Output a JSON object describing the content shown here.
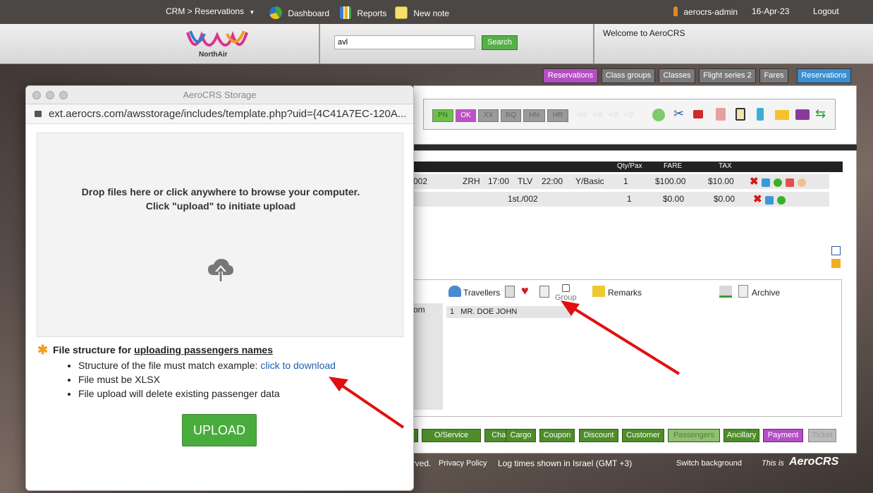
{
  "topbar": {
    "crm_menu": "CRM > Reservations",
    "dashboard": "Dashboard",
    "reports": "Reports",
    "new_note": "New note",
    "user": "aerocrs-admin",
    "date": "16-Apr-23",
    "logout": "Logout"
  },
  "header": {
    "logo_text": "NorthAir",
    "search_value": "avl",
    "search_button": "Search",
    "welcome": "Welcome to AeroCRS"
  },
  "nav_tabs": [
    "Reservations",
    "Class groups",
    "Classes",
    "Flight series 2",
    "Fares",
    "Reservations"
  ],
  "status_buttons": [
    "PN",
    "OK",
    "XX",
    "RQ",
    "HN",
    "HR"
  ],
  "table": {
    "headers": [
      "Qty/Pax",
      "FARE",
      "TAX"
    ],
    "rows": [
      {
        "col1": "002",
        "from": "ZRH",
        "dep": "17:00",
        "to": "TLV",
        "arr": "22:00",
        "cls": "Y/Basic",
        "qty": "1",
        "fare": "$100.00",
        "tax": "$10.00"
      },
      {
        "col1": "1st./002",
        "qty": "1",
        "fare": "$0.00",
        "tax": "$0.00"
      }
    ]
  },
  "passengers": {
    "travellers": "Travellers",
    "group": "Group",
    "remarks": "Remarks",
    "archive": "Archive",
    "partial_left": "om",
    "passenger_line": "1   MR. DOE JOHN"
  },
  "bottom_buttons": [
    "O/Service",
    "Charter",
    "Cargo",
    "Coupon",
    "Discount",
    "Customer",
    "Passengers",
    "Ancillary",
    "Payment",
    "Ticket"
  ],
  "footer": {
    "rights": "erved.",
    "privacy": "Privacy Policy",
    "log_times": "Log times shown in Israel (GMT +3)",
    "switch_bg": "Switch background",
    "this_is": "This is",
    "brand": "AeroCRS"
  },
  "modal": {
    "title": "AeroCRS Storage",
    "url": "ext.aerocrs.com/awsstorage/includes/template.php?uid={4C41A7EC-120A...",
    "drop_line1": "Drop files here or click anywhere to browse your computer.",
    "drop_line2": "Click \"upload\" to initiate upload",
    "info_title_prefix": "File structure for ",
    "info_title_link": "uploading passengers names",
    "bullet1_prefix": "Structure of the file must match example: ",
    "bullet1_link": "click to download",
    "bullet2": "File must be XLSX",
    "bullet3": "File upload will delete existing passenger data",
    "upload_button": "UPLOAD"
  },
  "colors": {
    "accent_green": "#4aab3d",
    "tab_purple": "#b44ec4",
    "tab_gray": "#7a7a7a",
    "tab_blue": "#3a8fd0",
    "arrow_red": "#e01010"
  }
}
